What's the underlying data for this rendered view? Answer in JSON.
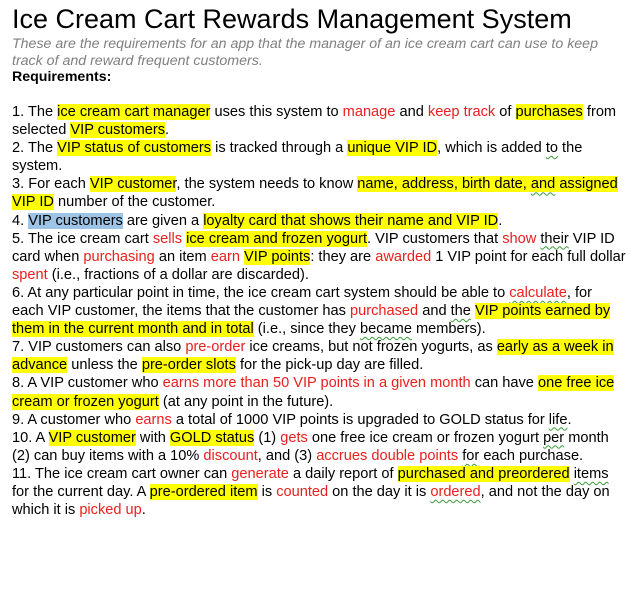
{
  "document": {
    "title": "Ice Cream Cart Rewards Management System",
    "subtitle": "These are the requirements for an app that the manager of an ice cream cart can use to keep track of and reward frequent customers.",
    "requirements_heading": "Requirements:",
    "highlight_colors": {
      "yellow": "#ffff00",
      "selection": "#9dc3e6",
      "emphasis_text": "#e8201e",
      "subtitle_text": "#7f7f7f"
    },
    "requirements": [
      {
        "segments": [
          {
            "t": "1. The "
          },
          {
            "t": "ice cream cart manager",
            "s": "hl"
          },
          {
            "t": " uses this system to "
          },
          {
            "t": "manage",
            "s": "red"
          },
          {
            "t": " and "
          },
          {
            "t": "keep track",
            "s": "red"
          },
          {
            "t": " of "
          },
          {
            "t": "purchases",
            "s": "hl"
          },
          {
            "t": " from selected "
          },
          {
            "t": "VIP customers",
            "s": "hl"
          },
          {
            "t": "."
          }
        ]
      },
      {
        "segments": [
          {
            "t": "2. The "
          },
          {
            "t": "VIP status of customers",
            "s": "hl"
          },
          {
            "t": " is tracked through a "
          },
          {
            "t": "unique VIP ID",
            "s": "hl"
          },
          {
            "t": ", which is added "
          },
          {
            "t": "to",
            "s": "sq"
          },
          {
            "t": " the system."
          }
        ]
      },
      {
        "segments": [
          {
            "t": "3. For each "
          },
          {
            "t": "VIP customer",
            "s": "hl"
          },
          {
            "t": ", the system needs to know "
          },
          {
            "t": "name, address, birth date, ",
            "s": "hl"
          },
          {
            "t": "and",
            "s": "hl sq"
          },
          {
            "t": " assigned VIP ID",
            "s": "hl"
          },
          {
            "t": " number of the customer."
          }
        ]
      },
      {
        "segments": [
          {
            "t": "4. "
          },
          {
            "t": "VIP customers",
            "s": "sel"
          },
          {
            "t": " are given a "
          },
          {
            "t": "loyalty card that shows their name and VIP ID",
            "s": "hl"
          },
          {
            "t": "."
          }
        ]
      },
      {
        "segments": [
          {
            "t": "5. The ice cream cart "
          },
          {
            "t": "sells",
            "s": "red"
          },
          {
            "t": " "
          },
          {
            "t": "ice cream and frozen yogurt",
            "s": "hl"
          },
          {
            "t": ". VIP customers that "
          },
          {
            "t": "show",
            "s": "red"
          },
          {
            "t": " "
          },
          {
            "t": "their",
            "s": "sq"
          },
          {
            "t": " VIP ID card when "
          },
          {
            "t": "purchasing",
            "s": "red"
          },
          {
            "t": " an item "
          },
          {
            "t": "earn",
            "s": "red"
          },
          {
            "t": " "
          },
          {
            "t": "VIP points",
            "s": "hl"
          },
          {
            "t": ": they are "
          },
          {
            "t": "awarded",
            "s": "red"
          },
          {
            "t": " 1 VIP point for each full dollar "
          },
          {
            "t": "spent",
            "s": "red"
          },
          {
            "t": " (i.e., fractions of a dollar are discarded)."
          }
        ]
      },
      {
        "segments": [
          {
            "t": "6. At any particular point in time, the ice cream cart system should be able to "
          },
          {
            "t": "calculate",
            "s": "red sq"
          },
          {
            "t": ", for each VIP customer, the items that the customer has "
          },
          {
            "t": "purchased",
            "s": "red"
          },
          {
            "t": " and "
          },
          {
            "t": "the",
            "s": "sq"
          },
          {
            "t": " "
          },
          {
            "t": "VIP points earned by them in the current month and in total",
            "s": "hl"
          },
          {
            "t": " (i.e., since they "
          },
          {
            "t": "became",
            "s": "sq"
          },
          {
            "t": " members)."
          }
        ]
      },
      {
        "segments": [
          {
            "t": "7. VIP customers can also "
          },
          {
            "t": "pre-order",
            "s": "red"
          },
          {
            "t": " ice creams, but not frozen yogurts, as "
          },
          {
            "t": "early as a week in advance",
            "s": "hl"
          },
          {
            "t": " unless the "
          },
          {
            "t": "pre-order slots",
            "s": "hl"
          },
          {
            "t": " for the pick-up day are filled."
          }
        ]
      },
      {
        "segments": [
          {
            "t": "8. A VIP customer who "
          },
          {
            "t": "earns more than 50 VIP points in a given month",
            "s": "red"
          },
          {
            "t": " can have "
          },
          {
            "t": "one free ice cream or frozen yogurt",
            "s": "hl"
          },
          {
            "t": " (at any point in the future)."
          }
        ]
      },
      {
        "segments": [
          {
            "t": "9. A customer who "
          },
          {
            "t": "earns",
            "s": "red"
          },
          {
            "t": " a total of 1000 VIP points is upgraded to GOLD status for "
          },
          {
            "t": "life",
            "s": "sq"
          },
          {
            "t": "."
          }
        ]
      },
      {
        "segments": [
          {
            "t": "10. A "
          },
          {
            "t": "VIP customer",
            "s": "hl"
          },
          {
            "t": " with "
          },
          {
            "t": "GOLD status",
            "s": "hl"
          },
          {
            "t": " (1) "
          },
          {
            "t": "gets",
            "s": "red"
          },
          {
            "t": " one free ice cream or frozen yogurt "
          },
          {
            "t": "per",
            "s": "sq"
          },
          {
            "t": " month (2) can buy items with a 10% "
          },
          {
            "t": "discount",
            "s": "red"
          },
          {
            "t": ", and (3) "
          },
          {
            "t": "accrues double points",
            "s": "red"
          },
          {
            "t": " "
          },
          {
            "t": "for",
            "s": "sq"
          },
          {
            "t": " each purchase."
          }
        ]
      },
      {
        "segments": [
          {
            "t": "11. The ice cream cart owner can "
          },
          {
            "t": "generate",
            "s": "red"
          },
          {
            "t": " a daily report of "
          },
          {
            "t": "purchased and preordered",
            "s": "hl"
          },
          {
            "t": " "
          },
          {
            "t": "items",
            "s": "sq"
          },
          {
            "t": " for the current day. A "
          },
          {
            "t": "pre-ordered item",
            "s": "hl"
          },
          {
            "t": " is "
          },
          {
            "t": "counted",
            "s": "red"
          },
          {
            "t": " on the day it is "
          },
          {
            "t": "ordered",
            "s": "red sq"
          },
          {
            "t": ", and not the day on which it is "
          },
          {
            "t": "picked up",
            "s": "red"
          },
          {
            "t": "."
          }
        ]
      }
    ]
  }
}
